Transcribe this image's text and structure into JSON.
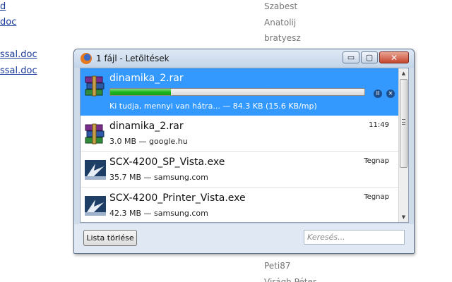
{
  "background": {
    "links": [
      "d",
      "doc",
      "ssal.doc",
      "ssal.doc"
    ],
    "names_top": [
      "Szabest",
      "Anatolij",
      "bratyesz"
    ],
    "names_bottom": [
      "Peti87",
      "Virágh Péter"
    ]
  },
  "window": {
    "title": "1 fájl - Letöltések",
    "caption_buttons": {
      "minimize": "▭",
      "maximize": "▢",
      "close": "✕"
    }
  },
  "downloads": [
    {
      "name": "dinamika_2.rar",
      "status": "Ki tudja, mennyi van hátra... — 84.3 KB (15.6 KB/mp)",
      "progress": 0.24,
      "icon": "winrar-archive-icon",
      "active": true
    },
    {
      "name": "dinamika_2.rar",
      "status": "3.0 MB — google.hu",
      "time": "11:49",
      "icon": "winrar-archive-icon"
    },
    {
      "name": "SCX-4200_SP_Vista.exe",
      "status": "35.7 MB — samsung.com",
      "time": "Tegnap",
      "icon": "installer-exe-icon"
    },
    {
      "name": "SCX-4200_Printer_Vista.exe",
      "status": "42.3 MB — samsung.com",
      "time": "Tegnap",
      "icon": "installer-exe-icon"
    }
  ],
  "controls": {
    "pause_glyph": "II",
    "cancel_glyph": "✕",
    "scroll_up": "▲",
    "scroll_down": "▼"
  },
  "footer": {
    "clear_label": "Lista törlése",
    "search_placeholder": "Keresés..."
  },
  "colors": {
    "selection": "#3399ff",
    "progress_fill": "#1fb51f",
    "link": "#1a3a9a",
    "close_button": "#c6452d"
  }
}
